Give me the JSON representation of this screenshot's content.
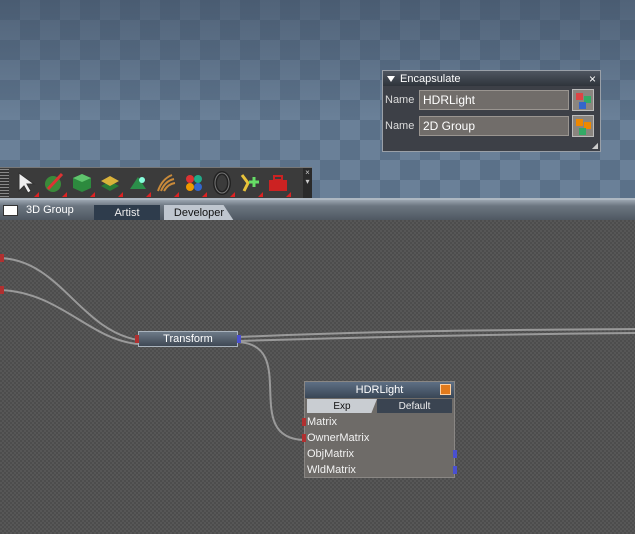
{
  "encapsulate": {
    "title": "Encapsulate",
    "close": "×",
    "rows": [
      {
        "label": "Name",
        "value": "HDRLight"
      },
      {
        "label": "Name",
        "value": "2D Group"
      }
    ]
  },
  "toolbar": {
    "tools": [
      "select-arrow-icon",
      "paint-icon",
      "cube-icon",
      "layers-icon",
      "transform-icon",
      "grass-icon",
      "spheres-icon",
      "torus-icon",
      "light-add-icon",
      "toolbox-icon"
    ]
  },
  "tabs": {
    "group_label": "3D Group",
    "items": [
      {
        "label": "Artist"
      },
      {
        "label": "Developer"
      }
    ]
  },
  "graph": {
    "transform_node": {
      "label": "Transform"
    },
    "hdr_node": {
      "title": "HDRLight",
      "mode_exp": "Exp",
      "mode_default": "Default",
      "ports": [
        {
          "label": "Matrix"
        },
        {
          "label": "OwnerMatrix"
        },
        {
          "label": "ObjMatrix"
        },
        {
          "label": "WldMatrix"
        }
      ]
    }
  },
  "colors": {
    "node_header": "#3f4854",
    "port_in": "#b03030",
    "port_out": "#4a50d0",
    "accent_orange": "#e27a1c"
  }
}
